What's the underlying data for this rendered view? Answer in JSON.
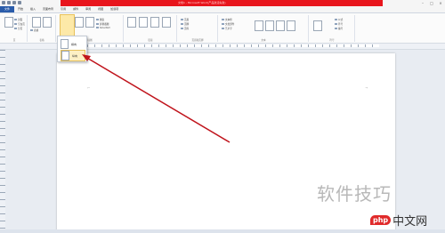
{
  "titlebar": {
    "title": "文档1 - Microsoft Word(产品激活失败)",
    "window_controls": [
      "minimize-icon",
      "maximize-icon",
      "close-icon"
    ]
  },
  "tabs": [
    "文件",
    "开始",
    "插入",
    "页面布局",
    "引用",
    "邮件",
    "审阅",
    "视图",
    "加载项"
  ],
  "ribbon": {
    "group_pages_label": "页",
    "group_table_label": "表格",
    "group_illustrations_label": "插图",
    "group_links_label": "链接",
    "group_header_label": "页眉和页脚",
    "group_text_label": "文本",
    "group_symbols_label": "符号",
    "buttons": [
      "封面",
      "空白页",
      "分页",
      "表格",
      "图片",
      "剪贴画",
      "形状",
      "SmartArt",
      "图表",
      "屏幕截图",
      "超链接",
      "书签",
      "交叉引用",
      "页眉",
      "页脚",
      "页码",
      "文本框",
      "文档部件",
      "艺术字",
      "首字下沉",
      "签名行",
      "日期和时间",
      "对象",
      "公式",
      "符号",
      "编号"
    ]
  },
  "dropdown": {
    "options": [
      "横向",
      "纵向"
    ],
    "selected_index": 1
  },
  "colors": {
    "title_bar_red": "#e8151c",
    "file_tab_blue": "#2a5caa",
    "arrow_red": "#c0141c",
    "highlight_yellow": "#fde9a8"
  },
  "watermark": {
    "text": "软件技巧",
    "badge_logo": "php",
    "badge_name": "中文网"
  }
}
